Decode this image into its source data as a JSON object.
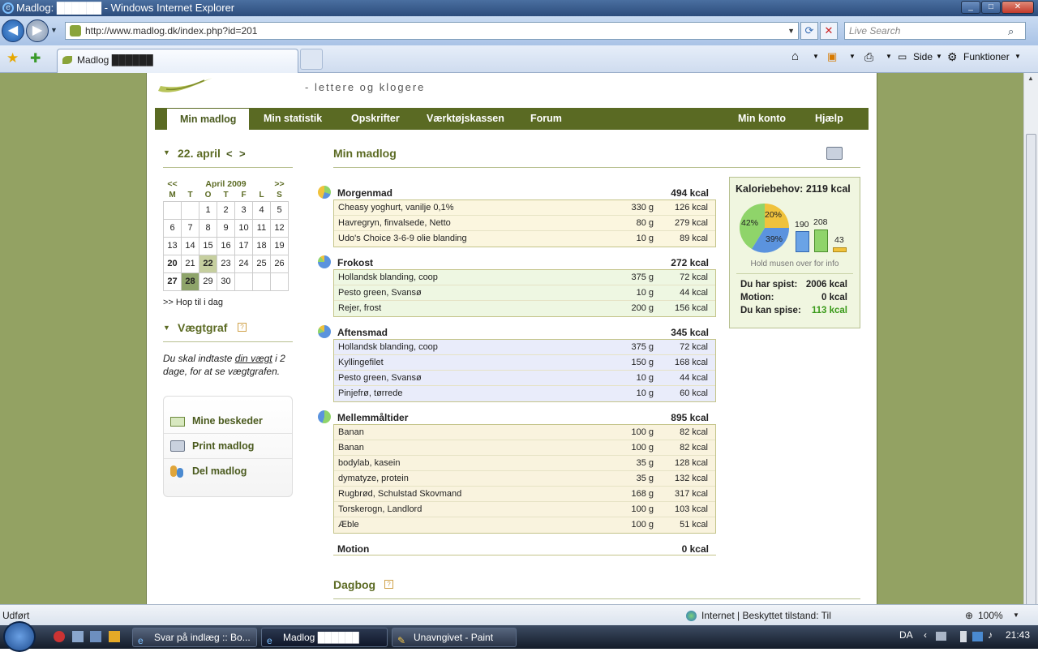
{
  "window": {
    "title": "Madlog: ██████ - Windows Internet Explorer",
    "btn_min": "_",
    "btn_max": "□",
    "btn_close": "✕"
  },
  "browser": {
    "url": "http://www.madlog.dk/index.php?id=201",
    "search_placeholder": "Live Search",
    "tab_title": "Madlog ██████",
    "tools": {
      "side": "Side",
      "funktioner": "Funktioner"
    }
  },
  "site": {
    "slogan": "- lettere og klogere",
    "nav": [
      "Min madlog",
      "Min statistik",
      "Opskrifter",
      "Værktøjskassen",
      "Forum"
    ],
    "nav_right": [
      "Min konto",
      "Hjælp"
    ]
  },
  "sidebar": {
    "date_heading": "22. april",
    "prev": "<",
    "next": ">",
    "calendar": {
      "prev_label": "<<",
      "month_label": "April 2009",
      "next_label": ">>",
      "weekdays": [
        "M",
        "T",
        "O",
        "T",
        "F",
        "L",
        "S"
      ],
      "weeks": [
        [
          "",
          "",
          "1",
          "2",
          "3",
          "4",
          "5"
        ],
        [
          "6",
          "7",
          "8",
          "9",
          "10",
          "11",
          "12"
        ],
        [
          "13",
          "14",
          "15",
          "16",
          "17",
          "18",
          "19"
        ],
        [
          "20",
          "21",
          "22",
          "23",
          "24",
          "25",
          "26"
        ],
        [
          "27",
          "28",
          "29",
          "30",
          "",
          "",
          ""
        ]
      ],
      "today": "22",
      "selected": "28"
    },
    "hop": ">> Hop til i dag",
    "weight_heading": "Vægtgraf",
    "help": "?",
    "weight_text_pre": "Du skal indtaste ",
    "weight_link": "din vægt",
    "weight_text_post": " i 2 dage, for at se vægtgrafen.",
    "links": [
      "Mine beskeder",
      "Print madlog",
      "Del madlog"
    ]
  },
  "main": {
    "heading": "Min madlog",
    "meals": [
      {
        "name": "Morgenmad",
        "kcal": "494 kcal",
        "items": [
          [
            "Cheasy yoghurt, vanilje 0,1%",
            "330 g",
            "126 kcal"
          ],
          [
            "Havregryn, finvalsede, Netto",
            "80 g",
            "279 kcal"
          ],
          [
            "Udo's Choice 3-6-9 olie blanding",
            "10 g",
            "89 kcal"
          ]
        ]
      },
      {
        "name": "Frokost",
        "kcal": "272 kcal",
        "items": [
          [
            "Hollandsk blanding, coop",
            "375 g",
            "72 kcal"
          ],
          [
            "Pesto green, Svansø",
            "10 g",
            "44 kcal"
          ],
          [
            "Rejer, frost",
            "200 g",
            "156 kcal"
          ]
        ]
      },
      {
        "name": "Aftensmad",
        "kcal": "345 kcal",
        "items": [
          [
            "Hollandsk blanding, coop",
            "375 g",
            "72 kcal"
          ],
          [
            "Kyllingefilet",
            "150 g",
            "168 kcal"
          ],
          [
            "Pesto green, Svansø",
            "10 g",
            "44 kcal"
          ],
          [
            "Pinjefrø, tørrede",
            "10 g",
            "60 kcal"
          ]
        ]
      },
      {
        "name": "Mellemmåltider",
        "kcal": "895 kcal",
        "items": [
          [
            "Banan",
            "100 g",
            "82 kcal"
          ],
          [
            "Banan",
            "100 g",
            "82 kcal"
          ],
          [
            "bodylab, kasein",
            "35 g",
            "128 kcal"
          ],
          [
            "dymatyze, protein",
            "35 g",
            "132 kcal"
          ],
          [
            "Rugbrød, Schulstad Skovmand",
            "168 g",
            "317 kcal"
          ],
          [
            "Torskerogn, Landlord",
            "100 g",
            "103 kcal"
          ],
          [
            "Æble",
            "100 g",
            "51 kcal"
          ]
        ]
      }
    ],
    "motion": {
      "name": "Motion",
      "kcal": "0 kcal"
    },
    "dagbog": "Dagbog"
  },
  "kbox": {
    "title": "Kaloriebehov: 2119 kcal",
    "pie": {
      "p1": "42%",
      "p2": "20%",
      "p3": "39%"
    },
    "bars": {
      "b1": "190",
      "b2": "208",
      "b3": "43",
      "v1": 190,
      "v2": 208,
      "v3": 43
    },
    "hint": "Hold musen over for info",
    "spist_label": "Du har spist:",
    "spist": "2006 kcal",
    "motion_label": "Motion:",
    "motion": "0 kcal",
    "kan_label": "Du kan spise:",
    "kan": "113 kcal"
  },
  "status": {
    "left": "Udført",
    "zone": "Internet | Beskyttet tilstand: Til",
    "zoom": "100%"
  },
  "taskbar": {
    "tasks": [
      "Svar på indlæg :: Bo...",
      "Madlog ██████",
      "Unavngivet - Paint"
    ],
    "lang": "DA",
    "time": "21:43"
  }
}
